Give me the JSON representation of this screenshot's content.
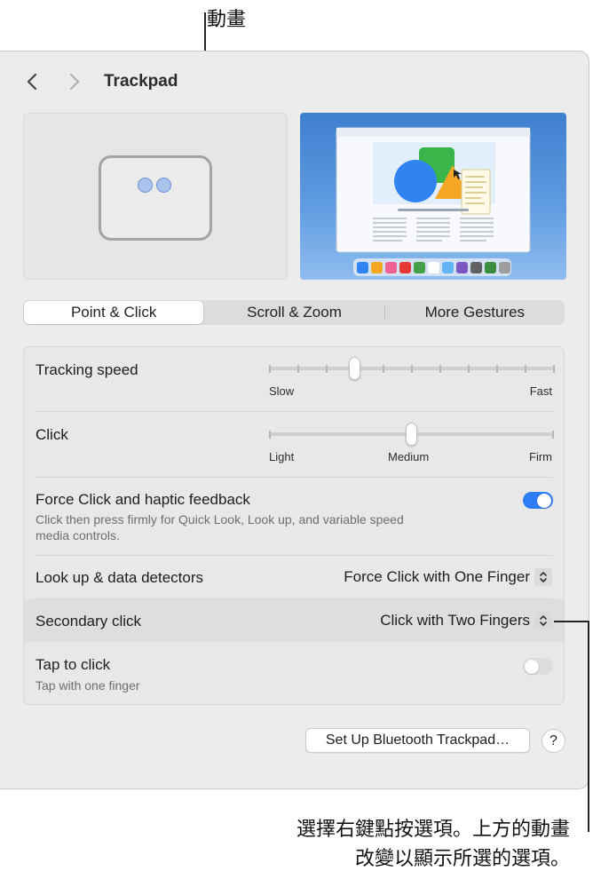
{
  "callouts": {
    "top": "動畫",
    "bottom_line1": "選擇右鍵點按選項。上方的動畫",
    "bottom_line2": "改變以顯示所選的選項。"
  },
  "window": {
    "title": "Trackpad"
  },
  "tabs": [
    {
      "label": "Point & Click",
      "selected": true
    },
    {
      "label": "Scroll & Zoom",
      "selected": false
    },
    {
      "label": "More Gestures",
      "selected": false
    }
  ],
  "settings": {
    "tracking_speed": {
      "label": "Tracking speed",
      "min_label": "Slow",
      "max_label": "Fast",
      "value_step": 3,
      "steps": 10
    },
    "click": {
      "label": "Click",
      "low": "Light",
      "mid": "Medium",
      "high": "Firm",
      "value_step": 1,
      "steps": 2
    },
    "force_click": {
      "label": "Force Click and haptic feedback",
      "description_line1": "Click then press firmly for Quick Look, Look up, and variable speed",
      "description_line2": "media controls.",
      "enabled": true
    },
    "lookup": {
      "label": "Look up & data detectors",
      "value": "Force Click with One Finger"
    },
    "secondary_click": {
      "label": "Secondary click",
      "value": "Click with Two Fingers"
    },
    "tap_to_click": {
      "label": "Tap to click",
      "description": "Tap with one finger",
      "enabled": false
    }
  },
  "buttons": {
    "setup_bluetooth": "Set Up Bluetooth Trackpad…",
    "help": "?"
  },
  "colors": {
    "accent": "#2e7cf6",
    "toggle_off": "#dddddd",
    "highlight_row": "#dedede"
  }
}
